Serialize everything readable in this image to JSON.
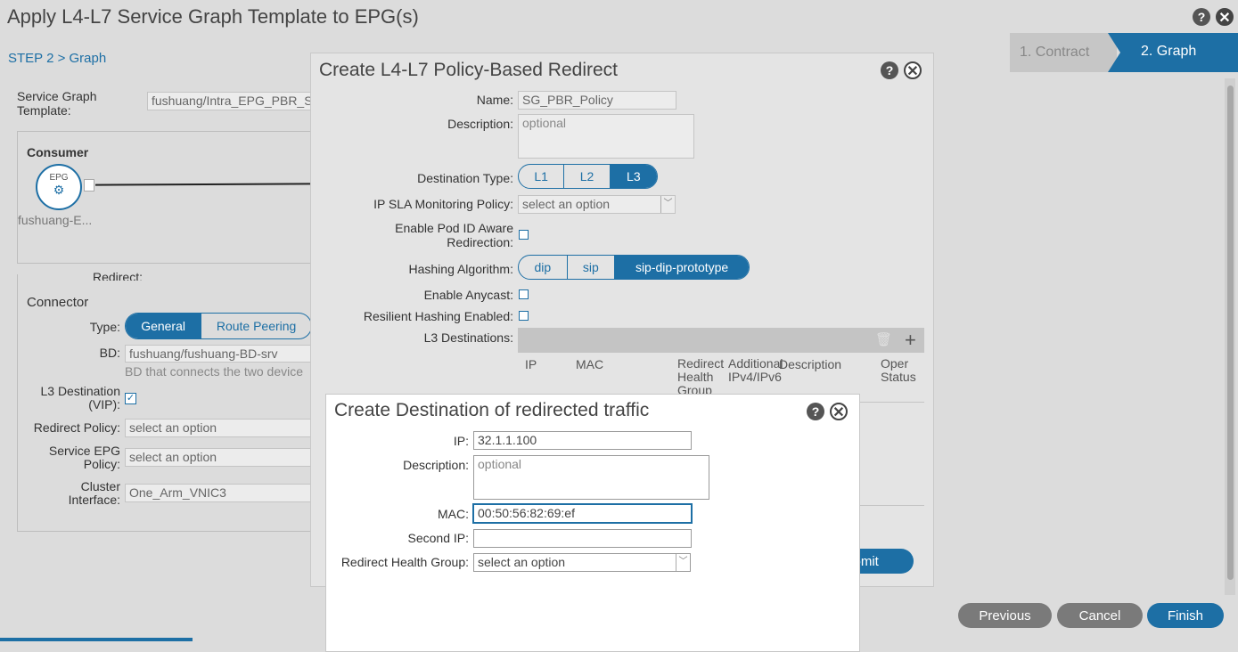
{
  "window": {
    "title": "Apply L4-L7 Service Graph Template to EPG(s)",
    "step_breadcrumb": "STEP 2 > Graph",
    "wizard_steps": [
      "1. Contract",
      "2. Graph"
    ],
    "footer": {
      "previous": "Previous",
      "cancel": "Cancel",
      "finish": "Finish"
    }
  },
  "background": {
    "sgt_label": "Service Graph Template:",
    "sgt_value": "fushuang/Intra_EPG_PBR_S",
    "consumer_label": "Consumer",
    "epg_label": "EPG",
    "epg_name": "fushuang-E...",
    "redirect_label": "Redirect:",
    "connector_title": "Connector",
    "type_label": "Type:",
    "type_options": [
      "General",
      "Route Peering"
    ],
    "bd_label": "BD:",
    "bd_value": "fushuang/fushuang-BD-srv",
    "bd_help": "BD that connects the two device",
    "l3dest_label": "L3 Destination (VIP):",
    "l3dest_checked": true,
    "redirect_policy_label": "Redirect Policy:",
    "redirect_policy_value": "select an option",
    "service_epg_label": "Service EPG Policy:",
    "service_epg_value": "select an option",
    "cluster_if_label": "Cluster Interface:",
    "cluster_if_value": "One_Arm_VNIC3"
  },
  "pbr_dialog": {
    "title": "Create L4-L7 Policy-Based Redirect",
    "name_label": "Name:",
    "name_value": "SG_PBR_Policy",
    "desc_label": "Description:",
    "desc_placeholder": "optional",
    "dest_type_label": "Destination Type:",
    "dest_type_options": [
      "L1",
      "L2",
      "L3"
    ],
    "dest_type_selected": "L3",
    "ipsla_label": "IP SLA Monitoring Policy:",
    "ipsla_value": "select an option",
    "pod_aware_label": "Enable Pod ID Aware Redirection:",
    "hashing_label": "Hashing Algorithm:",
    "hashing_options": [
      "dip",
      "sip",
      "sip-dip-prototype"
    ],
    "hashing_selected": "sip-dip-prototype",
    "anycast_label": "Enable Anycast:",
    "resilient_label": "Resilient Hashing Enabled:",
    "l3dest_label": "L3 Destinations:",
    "columns": [
      "IP",
      "MAC",
      "Redirect Health Group",
      "Additional IPv4/IPv6",
      "Description",
      "Oper Status"
    ],
    "submit_label": "Submit"
  },
  "dest_dialog": {
    "title": "Create Destination of redirected traffic",
    "ip_label": "IP:",
    "ip_value": "32.1.1.100",
    "desc_label": "Description:",
    "desc_placeholder": "optional",
    "mac_label": "MAC:",
    "mac_value": "00:50:56:82:69:ef",
    "second_ip_label": "Second IP:",
    "second_ip_value": "",
    "rhg_label": "Redirect Health Group:",
    "rhg_value": "select an option"
  },
  "colors": {
    "accent": "#1d6fa5",
    "overlay": "#dcdcdc",
    "dialog": "#ffffff"
  },
  "icons": [
    "help-icon",
    "close-icon",
    "trash-icon",
    "plus-icon",
    "epg-icon",
    "checkmark-icon"
  ]
}
